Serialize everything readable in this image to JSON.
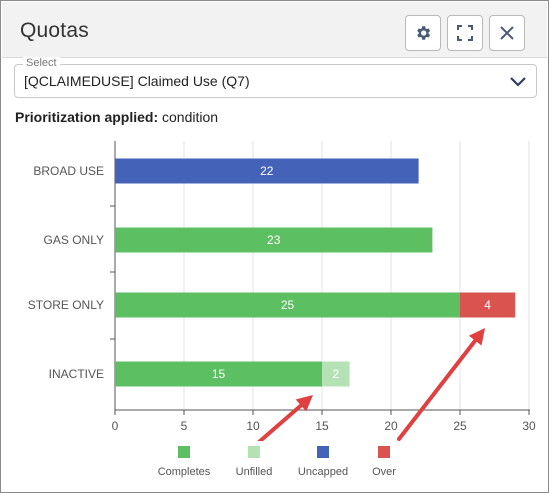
{
  "header": {
    "title": "Quotas",
    "settings_icon": "gear-icon",
    "fullscreen_icon": "fullscreen-icon",
    "close_icon": "close-icon"
  },
  "select": {
    "legend": "Select",
    "value": "[QCLAIMEDUSE] Claimed Use (Q7)"
  },
  "prioritization": {
    "label": "Prioritization applied:",
    "value": "condition"
  },
  "colors": {
    "completes": "#5cbf62",
    "unfilled": "#b5e2b5",
    "uncapped": "#4462b8",
    "over": "#d9534f",
    "arrow": "#e04040"
  },
  "chart_data": {
    "type": "bar",
    "orientation": "horizontal",
    "stacked": true,
    "categories": [
      "BROAD USE",
      "GAS ONLY",
      "STORE ONLY",
      "INACTIVE"
    ],
    "series": [
      {
        "name": "Completes",
        "values": [
          0,
          23,
          25,
          15
        ]
      },
      {
        "name": "Unfilled",
        "values": [
          0,
          0,
          0,
          2
        ]
      },
      {
        "name": "Uncapped",
        "values": [
          22,
          0,
          0,
          0
        ]
      },
      {
        "name": "Over",
        "values": [
          0,
          0,
          4,
          0
        ]
      }
    ],
    "xlim": [
      0,
      30
    ],
    "xticks": [
      "0",
      "5",
      "10",
      "15",
      "20",
      "25",
      "30"
    ],
    "grid": true,
    "legend_position": "bottom",
    "annotations": "two red arrows pointing to the Unfilled and Over legend items' bars"
  },
  "legend": {
    "items": [
      {
        "label": "Completes",
        "color": "#5cbf62"
      },
      {
        "label": "Unfilled",
        "color": "#b5e2b5"
      },
      {
        "label": "Uncapped",
        "color": "#4462b8"
      },
      {
        "label": "Over",
        "color": "#d9534f"
      }
    ]
  }
}
